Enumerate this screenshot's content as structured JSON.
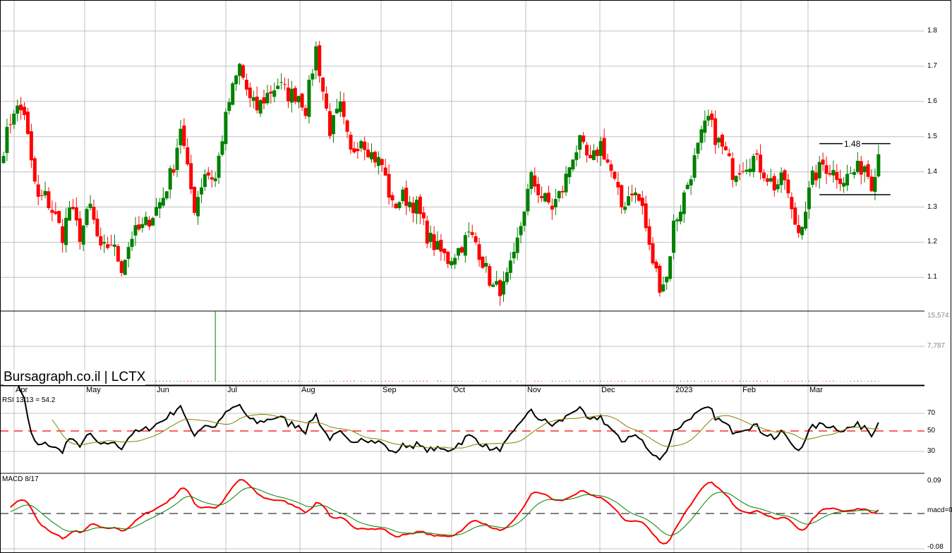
{
  "brand": "Bursagraph.co.il | LCTX",
  "months": [
    "Apr",
    "May",
    "Jun",
    "Jul",
    "Aug",
    "Sep",
    "Oct",
    "Nov",
    "Dec",
    "2023",
    "Feb",
    "Mar"
  ],
  "rsi_label": "RSI 13/13 = 54.2",
  "macd_label": "MACD 8/17",
  "resistance_label": "1.48",
  "price_axis": [
    "1.8",
    "1.7",
    "1.6",
    "1.5",
    "1.4",
    "1.3",
    "1.2",
    "1.1"
  ],
  "volume_axis": [
    "15,574",
    "7,787"
  ],
  "rsi_axis": [
    "70",
    "50",
    "30"
  ],
  "macd_axis": [
    "0.09",
    "macd=0",
    "-0.08"
  ],
  "colors": {
    "up": "#008000",
    "down": "#ff0000",
    "grid": "#c0c0c0",
    "signal": "#808000"
  },
  "chart_data": {
    "type": "candlestick",
    "title": "LCTX",
    "ylim": [
      1.03,
      1.87
    ],
    "support": 1.335,
    "resistance": 1.48,
    "rsi_period": 13,
    "rsi_value": 54.2,
    "macd": [
      8,
      17
    ],
    "volume_max": 15574,
    "close_anchors": [
      [
        0,
        1.47
      ],
      [
        3,
        1.58
      ],
      [
        6,
        1.57
      ],
      [
        8,
        1.42
      ],
      [
        10,
        1.32
      ],
      [
        12,
        1.33
      ],
      [
        15,
        1.27
      ],
      [
        17,
        1.22
      ],
      [
        19,
        1.3
      ],
      [
        22,
        1.22
      ],
      [
        25,
        1.3
      ],
      [
        28,
        1.17
      ],
      [
        31,
        1.2
      ],
      [
        34,
        1.13
      ],
      [
        37,
        1.22
      ],
      [
        40,
        1.24
      ],
      [
        43,
        1.28
      ],
      [
        46,
        1.33
      ],
      [
        49,
        1.42
      ],
      [
        51,
        1.53
      ],
      [
        53,
        1.4
      ],
      [
        55,
        1.3
      ],
      [
        58,
        1.4
      ],
      [
        61,
        1.38
      ],
      [
        63,
        1.5
      ],
      [
        65,
        1.6
      ],
      [
        68,
        1.7
      ],
      [
        71,
        1.6
      ],
      [
        73,
        1.58
      ],
      [
        76,
        1.62
      ],
      [
        79,
        1.65
      ],
      [
        82,
        1.62
      ],
      [
        85,
        1.62
      ],
      [
        87,
        1.58
      ],
      [
        90,
        1.75
      ],
      [
        92,
        1.63
      ],
      [
        94,
        1.52
      ],
      [
        97,
        1.58
      ],
      [
        100,
        1.45
      ],
      [
        103,
        1.5
      ],
      [
        106,
        1.45
      ],
      [
        109,
        1.42
      ],
      [
        112,
        1.3
      ],
      [
        115,
        1.33
      ],
      [
        119,
        1.3
      ],
      [
        122,
        1.22
      ],
      [
        125,
        1.18
      ],
      [
        128,
        1.15
      ],
      [
        131,
        1.18
      ],
      [
        134,
        1.22
      ],
      [
        136,
        1.2
      ],
      [
        139,
        1.12
      ],
      [
        141,
        1.07
      ],
      [
        144,
        1.07
      ],
      [
        147,
        1.15
      ],
      [
        150,
        1.3
      ],
      [
        152,
        1.38
      ],
      [
        155,
        1.33
      ],
      [
        158,
        1.3
      ],
      [
        161,
        1.35
      ],
      [
        164,
        1.45
      ],
      [
        166,
        1.48
      ],
      [
        169,
        1.42
      ],
      [
        172,
        1.48
      ],
      [
        175,
        1.4
      ],
      [
        178,
        1.3
      ],
      [
        181,
        1.35
      ],
      [
        184,
        1.3
      ],
      [
        186,
        1.18
      ],
      [
        189,
        1.08
      ],
      [
        191,
        1.1
      ],
      [
        193,
        1.25
      ],
      [
        195,
        1.3
      ],
      [
        198,
        1.4
      ],
      [
        201,
        1.5
      ],
      [
        203,
        1.55
      ],
      [
        205,
        1.5
      ],
      [
        208,
        1.45
      ],
      [
        210,
        1.4
      ],
      [
        213,
        1.42
      ],
      [
        216,
        1.44
      ],
      [
        219,
        1.4
      ],
      [
        222,
        1.36
      ],
      [
        225,
        1.38
      ],
      [
        227,
        1.28
      ],
      [
        229,
        1.23
      ],
      [
        231,
        1.3
      ],
      [
        233,
        1.38
      ],
      [
        236,
        1.42
      ],
      [
        239,
        1.4
      ],
      [
        242,
        1.38
      ],
      [
        245,
        1.4
      ],
      [
        248,
        1.42
      ],
      [
        250,
        1.37
      ],
      [
        252,
        1.45
      ]
    ],
    "volume_spike_day": 61
  }
}
